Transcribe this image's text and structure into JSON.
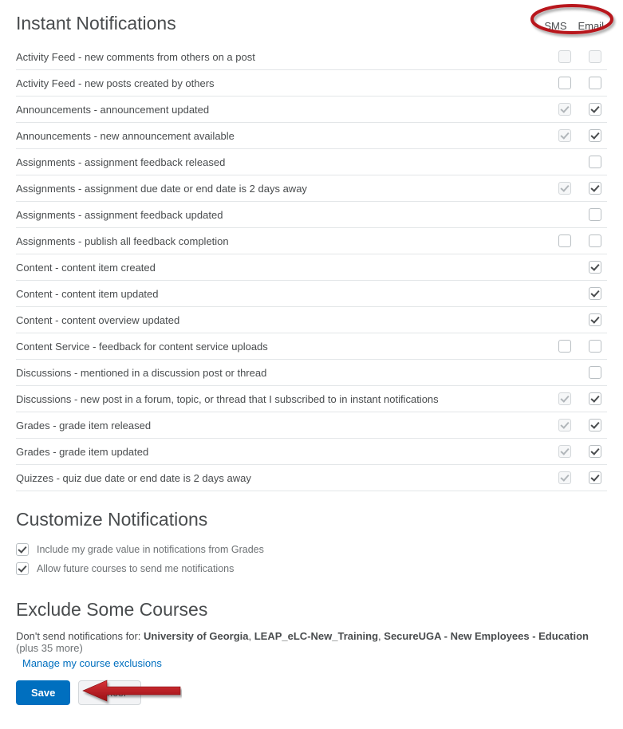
{
  "headings": {
    "instant": "Instant Notifications",
    "customize": "Customize Notifications",
    "exclude": "Exclude Some Courses"
  },
  "columns": {
    "sms": "SMS",
    "email": "Email"
  },
  "rows": [
    {
      "label": "Activity Feed - new comments from others on a post",
      "sms": {
        "present": true,
        "state": "disabled-unchecked"
      },
      "email": {
        "present": true,
        "state": "disabled-unchecked"
      }
    },
    {
      "label": "Activity Feed - new posts created by others",
      "sms": {
        "present": true,
        "state": "unchecked"
      },
      "email": {
        "present": true,
        "state": "unchecked"
      }
    },
    {
      "label": "Announcements - announcement updated",
      "sms": {
        "present": true,
        "state": "disabled-checked"
      },
      "email": {
        "present": true,
        "state": "checked"
      }
    },
    {
      "label": "Announcements - new announcement available",
      "sms": {
        "present": true,
        "state": "disabled-checked"
      },
      "email": {
        "present": true,
        "state": "checked"
      }
    },
    {
      "label": "Assignments - assignment feedback released",
      "sms": {
        "present": false
      },
      "email": {
        "present": true,
        "state": "unchecked"
      }
    },
    {
      "label": "Assignments - assignment due date or end date is 2 days away",
      "sms": {
        "present": true,
        "state": "disabled-checked"
      },
      "email": {
        "present": true,
        "state": "checked"
      }
    },
    {
      "label": "Assignments - assignment feedback updated",
      "sms": {
        "present": false
      },
      "email": {
        "present": true,
        "state": "unchecked"
      }
    },
    {
      "label": "Assignments - publish all feedback completion",
      "sms": {
        "present": true,
        "state": "unchecked"
      },
      "email": {
        "present": true,
        "state": "unchecked"
      }
    },
    {
      "label": "Content - content item created",
      "sms": {
        "present": false
      },
      "email": {
        "present": true,
        "state": "checked"
      }
    },
    {
      "label": "Content - content item updated",
      "sms": {
        "present": false
      },
      "email": {
        "present": true,
        "state": "checked"
      }
    },
    {
      "label": "Content - content overview updated",
      "sms": {
        "present": false
      },
      "email": {
        "present": true,
        "state": "checked"
      }
    },
    {
      "label": "Content Service - feedback for content service uploads",
      "sms": {
        "present": true,
        "state": "unchecked"
      },
      "email": {
        "present": true,
        "state": "unchecked"
      }
    },
    {
      "label": "Discussions - mentioned in a discussion post or thread",
      "sms": {
        "present": false
      },
      "email": {
        "present": true,
        "state": "unchecked"
      }
    },
    {
      "label": "Discussions - new post in a forum, topic, or thread that I subscribed to in instant notifications",
      "sms": {
        "present": true,
        "state": "disabled-checked"
      },
      "email": {
        "present": true,
        "state": "checked"
      }
    },
    {
      "label": "Grades - grade item released",
      "sms": {
        "present": true,
        "state": "disabled-checked"
      },
      "email": {
        "present": true,
        "state": "checked"
      }
    },
    {
      "label": "Grades - grade item updated",
      "sms": {
        "present": true,
        "state": "disabled-checked"
      },
      "email": {
        "present": true,
        "state": "checked"
      }
    },
    {
      "label": "Quizzes - quiz due date or end date is 2 days away",
      "sms": {
        "present": true,
        "state": "disabled-checked"
      },
      "email": {
        "present": true,
        "state": "checked"
      }
    }
  ],
  "customize": [
    {
      "label": "Include my grade value in notifications from Grades",
      "checked": true
    },
    {
      "label": "Allow future courses to send me notifications",
      "checked": true
    }
  ],
  "exclude": {
    "prefix": "Don't send notifications for: ",
    "courses": [
      "University of Georgia",
      "LEAP_eLC-New_Training",
      "SecureUGA - New Employees - Education"
    ],
    "more": " (plus 35 more)",
    "manage_link": "Manage my course exclusions"
  },
  "buttons": {
    "save": "Save",
    "cancel": "Cancel"
  },
  "colors": {
    "primary": "#006fbf",
    "annotation": "#b8141a"
  }
}
